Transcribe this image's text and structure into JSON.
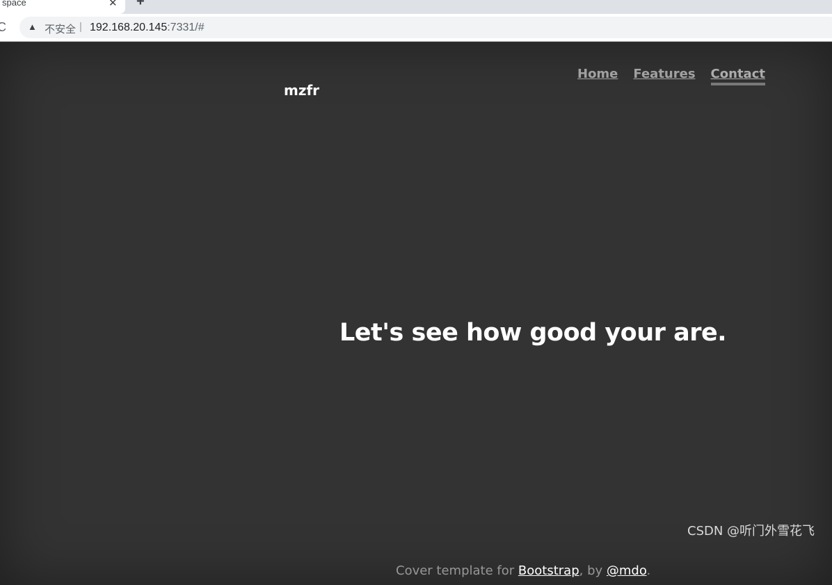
{
  "browser": {
    "tab_title": "space",
    "tab_close": "✕",
    "new_tab": "+",
    "reload": "C",
    "security_icon": "▲",
    "insecure_label": "不安全",
    "separator": "|",
    "url_host": "192.168.20.145",
    "url_rest": ":7331/#"
  },
  "site": {
    "brand": "mzfr",
    "nav": [
      {
        "label": "Home"
      },
      {
        "label": "Features"
      },
      {
        "label": "Contact"
      }
    ],
    "headline": "Let's see how good your are.",
    "footer": {
      "prefix": "Cover template for ",
      "link1": "Bootstrap",
      "middle": ", by ",
      "link2": "@mdo",
      "suffix": "."
    }
  },
  "watermark": "CSDN @听门外雪花飞"
}
